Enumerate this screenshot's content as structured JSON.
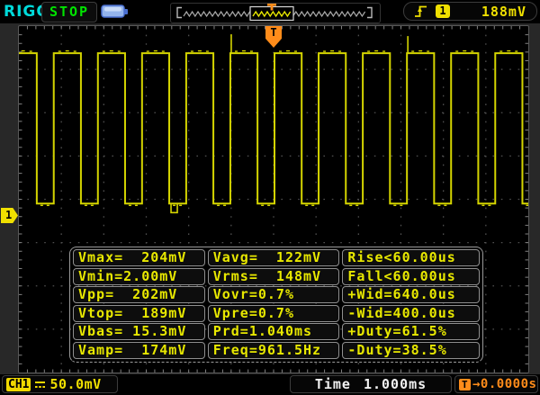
{
  "header": {
    "brand": "RIGOL",
    "acquisition_status": "STOP",
    "trigger_readout": {
      "slope_icon": "rising-edge-icon",
      "source": "1",
      "level": "188mV"
    }
  },
  "screen": {
    "trigger_marker": "T",
    "channel_marker": "1"
  },
  "measurements": {
    "cells": [
      "Vmax=  204mV",
      "Vavg=  122mV",
      "Rise<60.00us",
      "Vmin=2.00mV",
      "Vrms=  148mV",
      "Fall<60.00us",
      "Vpp=  202mV",
      "Vovr=0.7%",
      "+Wid=640.0us",
      "Vtop=  189mV",
      "Vpre=0.7%",
      "-Wid=400.0us",
      "Vbas= 15.3mV",
      "Prd=1.040ms",
      "+Duty=61.5%",
      "Vamp=  174mV",
      "Freq=961.5Hz",
      "-Duty=38.5%"
    ]
  },
  "footer": {
    "channel": {
      "label": "CH1",
      "coupling_icon": "dc-coupling-icon",
      "scale": "50.0mV"
    },
    "timebase": {
      "label": "Time",
      "value": "1.000ms"
    },
    "trigger_position": {
      "label": "T",
      "value": "→0.0000s"
    }
  },
  "chart_data": {
    "type": "line",
    "waveform": "square",
    "channel": "CH1",
    "volts_per_div_mV": 50.0,
    "time_per_div_ms": 1.0,
    "grid_divisions": {
      "horizontal": 12,
      "vertical": 8
    },
    "signal": {
      "vmax_mV": 204,
      "vmin_mV": 2.0,
      "vpp_mV": 202,
      "vtop_mV": 189,
      "vbase_mV": 15.3,
      "vamp_mV": 174,
      "vavg_mV": 122,
      "vrms_mV": 148,
      "overshoot_pct": 0.7,
      "preshoot_pct": 0.7,
      "period_ms": 1.04,
      "freq_Hz": 961.5,
      "rise_us_lt": 60.0,
      "fall_us_lt": 60.0,
      "pos_width_ms": 0.64,
      "neg_width_ms": 0.4,
      "pos_duty_pct": 61.5,
      "neg_duty_pct": 38.5
    },
    "trigger": {
      "source": "CH1",
      "slope": "rising",
      "level_mV": 188,
      "offset_s": 0.0
    },
    "colors": {
      "trace": "#d4d400",
      "grid_dots": "#4f4f4f",
      "edge_ticks": "#828282",
      "trigger_marker": "#ff8c1a",
      "channel_marker": "#f0e000"
    }
  }
}
